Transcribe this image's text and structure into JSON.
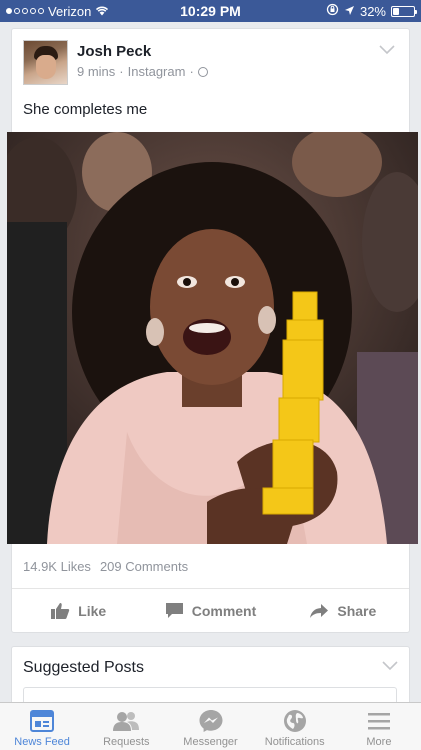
{
  "status_bar": {
    "carrier": "Verizon",
    "time": "10:29 PM",
    "battery": "32%",
    "battery_level": 0.32
  },
  "post": {
    "author": "Josh Peck",
    "time": "9 mins",
    "source": "Instagram",
    "text": "She completes me",
    "likes": "14.9K Likes",
    "comments": "209 Comments",
    "actions": {
      "like": "Like",
      "comment": "Comment",
      "share": "Share"
    }
  },
  "suggested": {
    "title": "Suggested Posts"
  },
  "tab_bar": {
    "tabs": [
      {
        "label": "News Feed",
        "icon": "news-feed-icon",
        "active": true
      },
      {
        "label": "Requests",
        "icon": "friends-icon",
        "active": false
      },
      {
        "label": "Messenger",
        "icon": "messenger-icon",
        "active": false
      },
      {
        "label": "Notifications",
        "icon": "globe-icon",
        "active": false
      },
      {
        "label": "More",
        "icon": "menu-icon",
        "active": false
      }
    ]
  },
  "colors": {
    "brand": "#3b5998",
    "active_tab": "#4e86d8",
    "muted": "#90949c"
  }
}
